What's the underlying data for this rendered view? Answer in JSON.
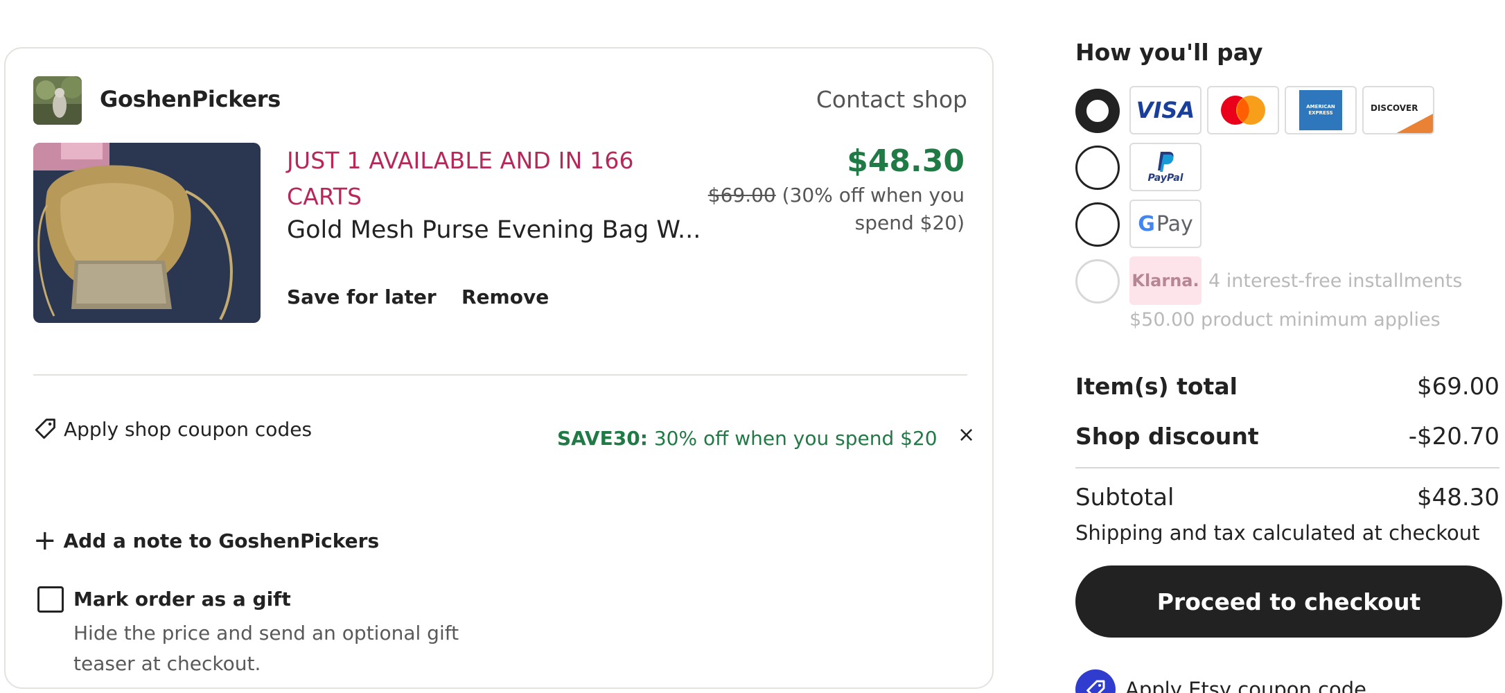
{
  "shop": {
    "name": "GoshenPickers",
    "contact_label": "Contact shop"
  },
  "item": {
    "availability": "JUST 1 AVAILABLE AND IN 166 CARTS",
    "title": "Gold Mesh Purse Evening Bag W...",
    "price_now": "$48.30",
    "price_was": "$69.00",
    "discount_note": "(30% off when you spend $20)",
    "save_for_later_label": "Save for later",
    "remove_label": "Remove"
  },
  "coupon": {
    "apply_label": "Apply shop coupon codes",
    "applied_code": "SAVE30:",
    "applied_desc": "30% off when you spend $20",
    "remove_glyph": "×"
  },
  "note": {
    "plus_glyph": "+",
    "label": "Add a note to GoshenPickers"
  },
  "gift": {
    "checked": false,
    "label": "Mark order as a gift",
    "help": "Hide the price and send an optional gift teaser at checkout."
  },
  "payment": {
    "title": "How you'll pay",
    "options": [
      {
        "id": "card",
        "selected": true,
        "logos": [
          "visa-logo",
          "mastercard-logo",
          "amex-logo",
          "discover-logo"
        ]
      },
      {
        "id": "paypal",
        "selected": false,
        "logos": [
          "paypal-logo"
        ]
      },
      {
        "id": "gpay",
        "selected": false,
        "logos": [
          "google-pay-logo"
        ]
      },
      {
        "id": "klarna",
        "selected": false,
        "disabled": true,
        "logos": [
          "klarna-logo"
        ]
      }
    ],
    "visa_text": "VISA",
    "amex_text": "AMERICAN EXPRESS",
    "discover_text": "DISCOVER",
    "paypal_text": "PayPal",
    "gpay_g": "G",
    "gpay_text": "Pay",
    "klarna_text": "Klarna.",
    "klarna_note": "4 interest-free installments",
    "klarna_min": "$50.00 product minimum applies"
  },
  "summary": {
    "items_total_label": "Item(s) total",
    "items_total_value": "$69.00",
    "shop_discount_label": "Shop discount",
    "shop_discount_value": "-$20.70",
    "subtotal_label": "Subtotal",
    "subtotal_value": "$48.30",
    "shipping_note": "Shipping and tax calculated at checkout"
  },
  "checkout": {
    "button_label": "Proceed to checkout",
    "etsy_coupon_label": "Apply Etsy coupon code"
  },
  "colors": {
    "price_green": "#1f7a45",
    "availability_red": "#b7275a",
    "button_dark": "#222222",
    "coupon_badge_blue": "#2f3ccd"
  }
}
